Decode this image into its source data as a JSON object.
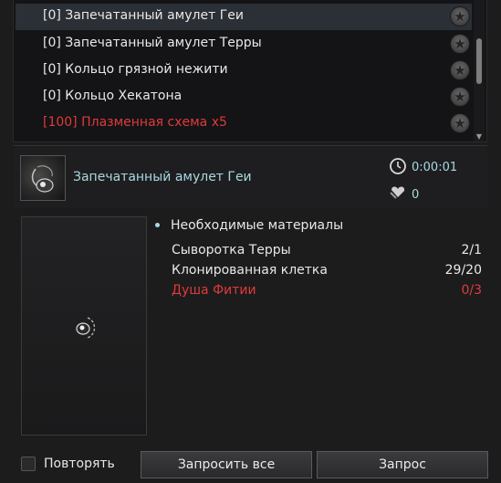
{
  "list": {
    "items": [
      {
        "label": "[0] Запечатанный амулет Геи",
        "selected": true,
        "color": "#e8e8e8",
        "star": "star-icon"
      },
      {
        "label": "[0] Запечатанный амулет Терры",
        "selected": false,
        "color": "#e8e8e8",
        "star": "star-icon"
      },
      {
        "label": "[0] Кольцо грязной нежити",
        "selected": false,
        "color": "#e8e8e8",
        "star": "star-icon"
      },
      {
        "label": "[0] Кольцо Хекатона",
        "selected": false,
        "color": "#e8e8e8",
        "star": "star-icon"
      },
      {
        "label": "[100] Плазменная схема x5",
        "selected": false,
        "color": "#e03a3a",
        "star": "star-icon"
      }
    ]
  },
  "detail": {
    "title": "Запечатанный амулет Геи",
    "timer": "0:00:01",
    "favor_count": "0",
    "materials_heading": "Необходимые материалы",
    "materials": [
      {
        "name": "Сыворотка Терры",
        "count": "2/1",
        "missing": false
      },
      {
        "name": "Клонированная клетка",
        "count": "29/20",
        "missing": false
      },
      {
        "name": "Душа Фитии",
        "count": "0/3",
        "missing": true
      }
    ]
  },
  "footer": {
    "repeat_label": "Повторять",
    "repeat_checked": false,
    "request_all_label": "Запросить все",
    "request_label": "Запрос"
  },
  "colors": {
    "accent_text": "#a9d9e0",
    "missing": "#e03a3a",
    "selected_row": "#2b2f36"
  }
}
